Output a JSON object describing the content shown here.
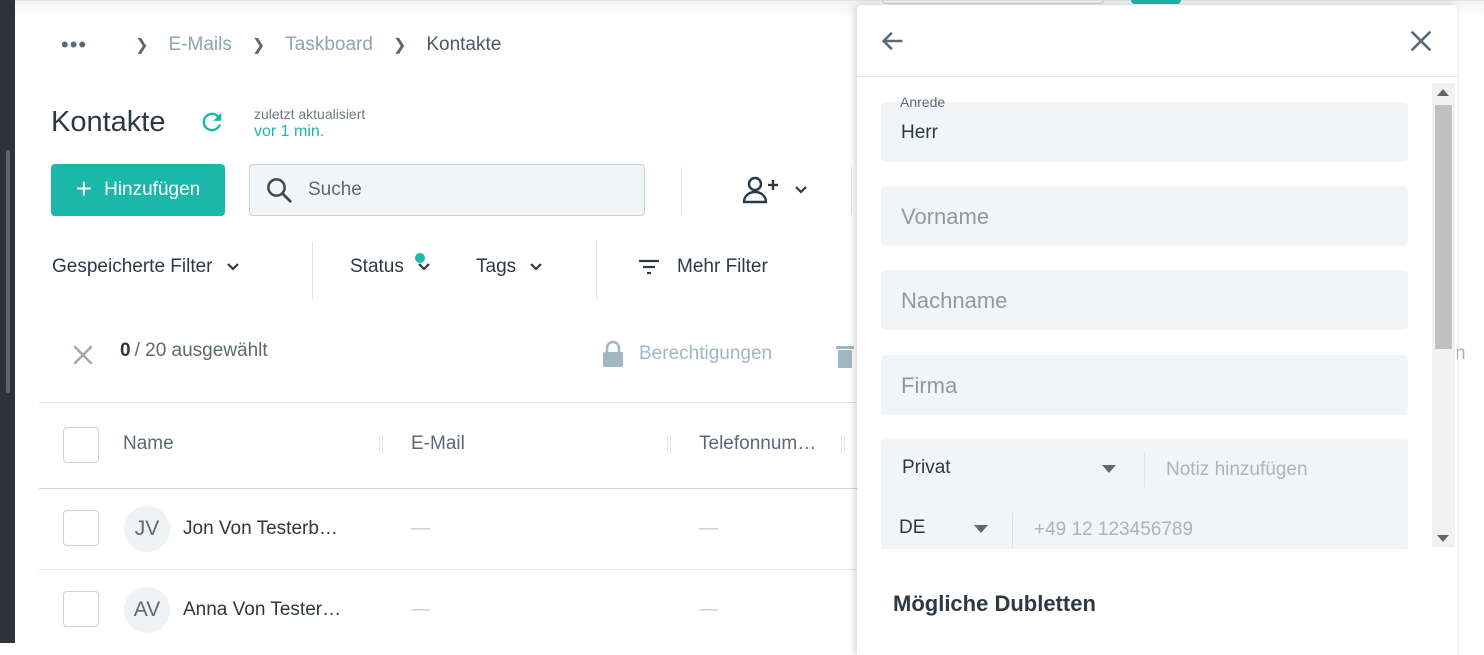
{
  "breadcrumb": {
    "more": "•••",
    "items": [
      "E-Mails",
      "Taskboard"
    ],
    "current": "Kontakte"
  },
  "page": {
    "title": "Kontakte",
    "updated_label": "zuletzt aktualisiert",
    "updated_ago": "vor 1 min."
  },
  "toolbar": {
    "add_label": "Hinzufügen",
    "search_placeholder": "Suche"
  },
  "filters": {
    "saved": "Gespeicherte Filter",
    "status": "Status",
    "tags": "Tags",
    "more": "Mehr Filter"
  },
  "selection": {
    "count": "0",
    "total_text": "/ 20 ausgewählt",
    "permissions": "Berechtigungen"
  },
  "table": {
    "columns": [
      "Name",
      "E-Mail",
      "Telefonnum…"
    ],
    "rows": [
      {
        "initials": "JV",
        "name": "Jon  Von Testerb…",
        "email": "—",
        "phone": "—"
      },
      {
        "initials": "AV",
        "name": "Anna  Von Tester…",
        "email": "—",
        "phone": "—"
      }
    ]
  },
  "panel": {
    "salutation_label": "Anrede",
    "salutation_value": "Herr",
    "firstname_placeholder": "Vorname",
    "lastname_placeholder": "Nachname",
    "company_placeholder": "Firma",
    "phone_type": "Privat",
    "phone_note_placeholder": "Notiz hinzufügen",
    "country": "DE",
    "phone_placeholder": "+49 12 123456789",
    "duplicates_title": "Mögliche Dubletten"
  },
  "colors": {
    "accent": "#1bb7a8",
    "muted": "#9fb8c1"
  }
}
